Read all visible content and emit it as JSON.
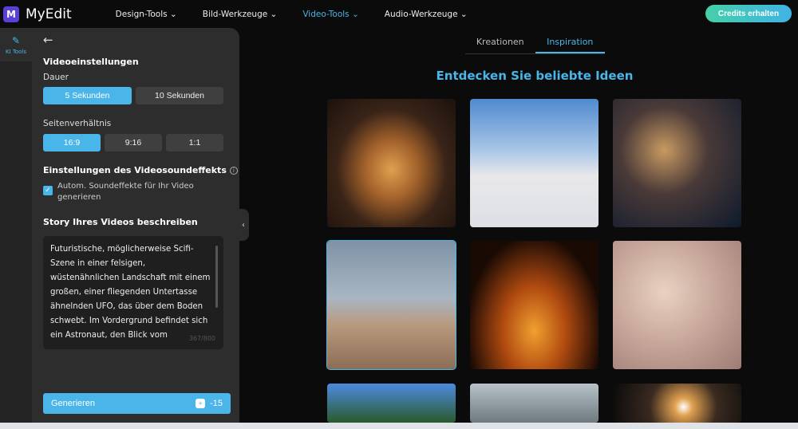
{
  "app": {
    "logo_letter": "M",
    "name": "MyEdit"
  },
  "nav": [
    "Design-Tools ⌄",
    "Bild-Werkzeuge ⌄",
    "Video-Tools ⌄",
    "Audio-Werkzeuge ⌄"
  ],
  "credits_label": "Credits erhalten",
  "rail": {
    "label": "KI Tools"
  },
  "panel": {
    "title": "Videoeinstellungen",
    "duration_label": "Dauer",
    "duration_options": [
      "5 Sekunden",
      "10 Sekunden"
    ],
    "ratio_label": "Seitenverhältnis",
    "ratio_options": [
      "16:9",
      "9:16",
      "1:1"
    ],
    "sound_title": "Einstellungen des Videosoundeffekts",
    "sound_checkbox": "Autom. Soundeffekte für Ihr Video generieren",
    "story_title": "Story Ihres Videos beschreiben",
    "story_text": "Futuristische, möglicherweise Scifi-Szene in einer felsigen, wüstenähnlichen Landschaft mit einem großen, einer fliegenden Untertasse ähnelnden UFO, das über dem Boden schwebt. Im Vordergrund befindet sich ein Astronaut, den Blick vom Betrachter abgewandt. Er",
    "char_count": "367/800",
    "generate_label": "Generieren",
    "generate_cost": "-15"
  },
  "tabs": [
    "Kreationen",
    "Inspiration"
  ],
  "heading": "Entdecken Sie beliebte Ideen"
}
